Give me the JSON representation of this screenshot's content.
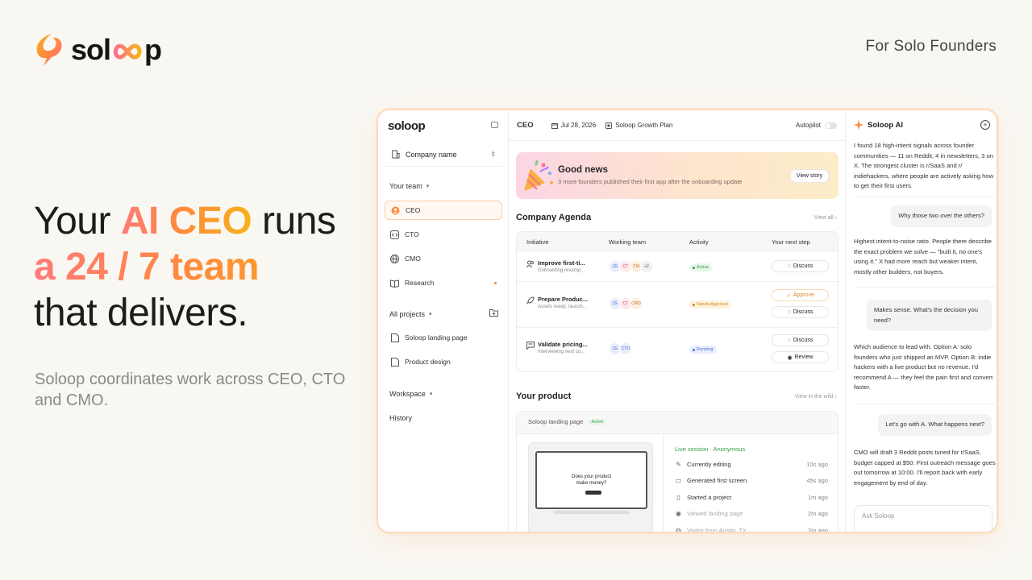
{
  "brand": {
    "name": "soloop",
    "name_left": "sol",
    "name_right": "p"
  },
  "tagline": "For Solo Founders",
  "headline": {
    "l1_a": "Your ",
    "l1_b": "AI CEO",
    "l1_c": " runs",
    "l2": "a 24 / 7 team",
    "l3": "that delivers."
  },
  "subhead": "Soloop coordinates work across CEO, CTO and CMO.",
  "colors": {
    "accent_start": "#ff7a7a",
    "accent_mid": "#ff8a3c",
    "accent_end": "#f7b21b",
    "active_green": "#3a9a4a"
  },
  "sidebar": {
    "logo": "soloop",
    "company": "Company name",
    "team_label": "Your team",
    "team": [
      {
        "label": "CEO",
        "icon": "avatar-icon"
      },
      {
        "label": "CTO",
        "icon": "code-icon"
      },
      {
        "label": "CMO",
        "icon": "globe-icon"
      },
      {
        "label": "Research",
        "icon": "book-icon"
      }
    ],
    "projects_label": "All projects",
    "projects": [
      {
        "label": "Soloop landing page",
        "icon": "file-icon"
      },
      {
        "label": "Product design",
        "icon": "file-icon"
      }
    ],
    "workspace_label": "Workspace",
    "history_label": "History"
  },
  "topbar": {
    "role": "CEO",
    "date": "Jul 28, 2026",
    "plan": "Soloop Growth Plan",
    "autopilot": "Autopilot"
  },
  "news": {
    "title": "Good news",
    "subtitle": "3 more founders published their first app after the onboarding update",
    "button": "View story"
  },
  "agenda": {
    "title": "Company Agenda",
    "link": "View all",
    "columns": [
      "Initiative",
      "Working team",
      "Activity",
      "Your next step"
    ],
    "rows": [
      {
        "name": "Improve first-ti...",
        "desc": "Onboarding revamp...",
        "avatars": [
          "CE",
          "CT",
          "CM",
          "+2"
        ],
        "status": "Active",
        "actions": [
          "Discuss"
        ]
      },
      {
        "name": "Prepare Produc...",
        "desc": "Assets ready; launch...",
        "avatars": [
          "CE",
          "CT",
          "CMO"
        ],
        "status": "Needs Approval",
        "actions": [
          "Approve",
          "Discuss"
        ]
      },
      {
        "name": "Validate pricing...",
        "desc": "Interviewing next co...",
        "avatars": [
          "CE",
          "CTO"
        ],
        "status": "Running",
        "actions": [
          "Discuss",
          "Review"
        ]
      }
    ]
  },
  "product": {
    "title": "Your product",
    "link": "View in the wild",
    "project": "Soloop landing page",
    "badge": "Active",
    "preview_title_1": "Does your product",
    "preview_title_2": "make money?",
    "session": "Live session · Anonymous",
    "activity": [
      {
        "label": "Currently editing",
        "time": "10s ago",
        "icon": "pencil-icon"
      },
      {
        "label": "Generated first screen",
        "time": "45s ago",
        "icon": "monitor-icon"
      },
      {
        "label": "Started a project",
        "time": "1m ago",
        "icon": "file-icon"
      },
      {
        "label": "Viewed landing page",
        "time": "2m ago",
        "icon": "eye-icon"
      },
      {
        "label": "Visitor from Austin, TX",
        "time": "2m ago",
        "icon": "globe-icon"
      }
    ]
  },
  "chat": {
    "title": "Soloop AI",
    "m1": "I found 18 high-intent signals across founder communities — 11 on Reddit, 4 in newsletters, 3 on X. The strongest cluster is r/SaaS and r/ indiehackers, where people are actively asking how to get their first users.",
    "u1": "Why those two over the others?",
    "m2": "Highest intent-to-noise ratio. People there describe the exact problem we solve — \"built it, no one's using it.\" X had more reach but weaker intent, mostly other builders, not buyers.",
    "u2": "Makes sense. What's the decision you need?",
    "m3": "Which audience to lead with. Option A: solo founders who just shipped an MVP. Option B: indie hackers with a live product but no revenue. I'd recommend A — they feel the pain first and convert faster.",
    "u3": "Let's go with A. What happens next?",
    "m4": "CMO will draft 3 Reddit posts tuned for r/SaaS, budget capped at $50. First outreach message goes out tomorrow at 10:00. I'll report back with early engagement by end of day.",
    "placeholder": "Ask Soloop"
  }
}
